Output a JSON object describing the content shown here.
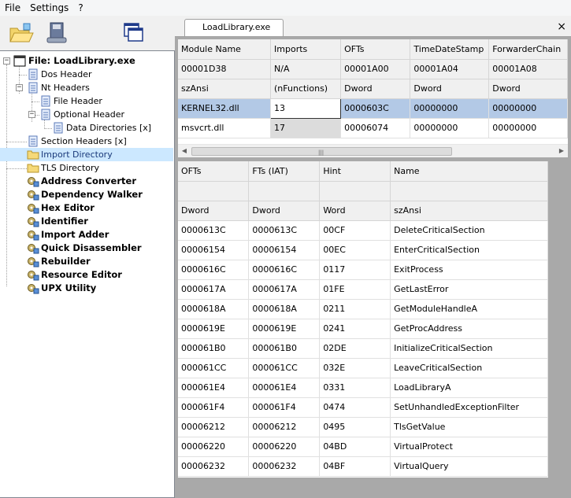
{
  "menu": [
    "File",
    "Settings",
    "?"
  ],
  "tab": {
    "label": "LoadLibrary.exe",
    "close": "×"
  },
  "tree": {
    "root": "File: LoadLibrary.exe",
    "items": [
      {
        "label": "Dos Header"
      },
      {
        "label": "Nt Headers"
      },
      {
        "label": "File Header"
      },
      {
        "label": "Optional Header"
      },
      {
        "label": "Data Directories [x]"
      },
      {
        "label": "Section Headers [x]"
      },
      {
        "label": "Import Directory"
      },
      {
        "label": "TLS Directory"
      },
      {
        "label": "Address Converter"
      },
      {
        "label": "Dependency Walker"
      },
      {
        "label": "Hex Editor"
      },
      {
        "label": "Identifier"
      },
      {
        "label": "Import Adder"
      },
      {
        "label": "Quick Disassembler"
      },
      {
        "label": "Rebuilder"
      },
      {
        "label": "Resource Editor"
      },
      {
        "label": "UPX Utility"
      }
    ]
  },
  "modules_table": {
    "headers": [
      "Module Name",
      "Imports",
      "OFTs",
      "TimeDateStamp",
      "ForwarderChain"
    ],
    "offsets": [
      "00001D38",
      "N/A",
      "00001A00",
      "00001A04",
      "00001A08"
    ],
    "types": [
      "szAnsi",
      "(nFunctions)",
      "Dword",
      "Dword",
      "Dword"
    ],
    "rows": [
      [
        "KERNEL32.dll",
        "13",
        "0000603C",
        "00000000",
        "00000000"
      ],
      [
        "msvcrt.dll",
        "17",
        "00006074",
        "00000000",
        "00000000"
      ]
    ]
  },
  "functions_table": {
    "headers": [
      "OFTs",
      "FTs (IAT)",
      "Hint",
      "Name"
    ],
    "blank": [
      "",
      "",
      "",
      ""
    ],
    "types": [
      "Dword",
      "Dword",
      "Word",
      "szAnsi"
    ],
    "rows": [
      [
        "0000613C",
        "0000613C",
        "00CF",
        "DeleteCriticalSection"
      ],
      [
        "00006154",
        "00006154",
        "00EC",
        "EnterCriticalSection"
      ],
      [
        "0000616C",
        "0000616C",
        "0117",
        "ExitProcess"
      ],
      [
        "0000617A",
        "0000617A",
        "01FE",
        "GetLastError"
      ],
      [
        "0000618A",
        "0000618A",
        "0211",
        "GetModuleHandleA"
      ],
      [
        "0000619E",
        "0000619E",
        "0241",
        "GetProcAddress"
      ],
      [
        "000061B0",
        "000061B0",
        "02DE",
        "InitializeCriticalSection"
      ],
      [
        "000061CC",
        "000061CC",
        "032E",
        "LeaveCriticalSection"
      ],
      [
        "000061E4",
        "000061E4",
        "0331",
        "LoadLibraryA"
      ],
      [
        "000061F4",
        "000061F4",
        "0474",
        "SetUnhandledExceptionFilter"
      ],
      [
        "00006212",
        "00006212",
        "0495",
        "TlsGetValue"
      ],
      [
        "00006220",
        "00006220",
        "04BD",
        "VirtualProtect"
      ],
      [
        "00006232",
        "00006232",
        "04BF",
        "VirtualQuery"
      ]
    ]
  }
}
